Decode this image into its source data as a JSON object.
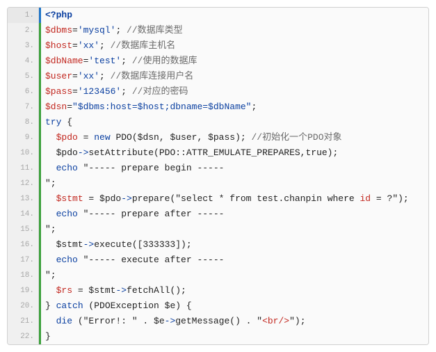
{
  "code": {
    "language": "php",
    "active_line": 1,
    "gutter_color": "#3ba03b",
    "active_gutter_color": "#1f74c7",
    "lines": [
      {
        "n": 1,
        "tokens": [
          {
            "t": "<?php",
            "c": "meta"
          }
        ]
      },
      {
        "n": 2,
        "tokens": [
          {
            "t": "$dbms",
            "c": "var"
          },
          {
            "t": "=",
            "c": "op"
          },
          {
            "t": "'mysql'",
            "c": "str"
          },
          {
            "t": "; ",
            "c": "op"
          },
          {
            "t": "//数据库类型",
            "c": "cmt"
          }
        ]
      },
      {
        "n": 3,
        "tokens": [
          {
            "t": "$host",
            "c": "var"
          },
          {
            "t": "=",
            "c": "op"
          },
          {
            "t": "'xx'",
            "c": "str"
          },
          {
            "t": "; ",
            "c": "op"
          },
          {
            "t": "//数据库主机名",
            "c": "cmt"
          }
        ]
      },
      {
        "n": 4,
        "tokens": [
          {
            "t": "$dbName",
            "c": "var"
          },
          {
            "t": "=",
            "c": "op"
          },
          {
            "t": "'test'",
            "c": "str"
          },
          {
            "t": "; ",
            "c": "op"
          },
          {
            "t": "//使用的数据库",
            "c": "cmt"
          }
        ]
      },
      {
        "n": 5,
        "tokens": [
          {
            "t": "$user",
            "c": "var"
          },
          {
            "t": "=",
            "c": "op"
          },
          {
            "t": "'xx'",
            "c": "str"
          },
          {
            "t": "; ",
            "c": "op"
          },
          {
            "t": "//数据库连接用户名",
            "c": "cmt"
          }
        ]
      },
      {
        "n": 6,
        "tokens": [
          {
            "t": "$pass",
            "c": "var"
          },
          {
            "t": "=",
            "c": "op"
          },
          {
            "t": "'123456'",
            "c": "str"
          },
          {
            "t": "; ",
            "c": "op"
          },
          {
            "t": "//对应的密码",
            "c": "cmt"
          }
        ]
      },
      {
        "n": 7,
        "tokens": [
          {
            "t": "$dsn",
            "c": "var"
          },
          {
            "t": "=",
            "c": "op"
          },
          {
            "t": "\"$dbms:host=$host;dbname=$dbName\"",
            "c": "str"
          },
          {
            "t": ";",
            "c": "op"
          }
        ]
      },
      {
        "n": 8,
        "tokens": [
          {
            "t": "try",
            "c": "kw"
          },
          {
            "t": " {",
            "c": "op"
          }
        ]
      },
      {
        "n": 9,
        "tokens": [
          {
            "t": "  ",
            "c": "plain"
          },
          {
            "t": "$pdo",
            "c": "var"
          },
          {
            "t": " = ",
            "c": "op"
          },
          {
            "t": "new",
            "c": "kw"
          },
          {
            "t": " PDO($dsn, $user, $pass); ",
            "c": "plain"
          },
          {
            "t": "//初始化一个PDO对象",
            "c": "cmt"
          }
        ]
      },
      {
        "n": 10,
        "tokens": [
          {
            "t": "  $pdo",
            "c": "plain"
          },
          {
            "t": "->",
            "c": "arrow"
          },
          {
            "t": "setAttribute(PDO::ATTR_EMULATE_PREPARES,true);",
            "c": "plain"
          }
        ]
      },
      {
        "n": 11,
        "tokens": [
          {
            "t": "  ",
            "c": "plain"
          },
          {
            "t": "echo",
            "c": "kw"
          },
          {
            "t": " \"----- prepare begin -----",
            "c": "plain"
          }
        ]
      },
      {
        "n": 12,
        "tokens": [
          {
            "t": "\";",
            "c": "plain"
          }
        ]
      },
      {
        "n": 13,
        "tokens": [
          {
            "t": "  ",
            "c": "plain"
          },
          {
            "t": "$stmt",
            "c": "var"
          },
          {
            "t": " = $pdo",
            "c": "plain"
          },
          {
            "t": "->",
            "c": "arrow"
          },
          {
            "t": "prepare(\"select * from test.chanpin where ",
            "c": "plain"
          },
          {
            "t": "id",
            "c": "id"
          },
          {
            "t": " = ?\");",
            "c": "plain"
          }
        ]
      },
      {
        "n": 14,
        "tokens": [
          {
            "t": "  ",
            "c": "plain"
          },
          {
            "t": "echo",
            "c": "kw"
          },
          {
            "t": " \"----- prepare after -----",
            "c": "plain"
          }
        ]
      },
      {
        "n": 15,
        "tokens": [
          {
            "t": "\";",
            "c": "plain"
          }
        ]
      },
      {
        "n": 16,
        "tokens": [
          {
            "t": "  $stmt",
            "c": "plain"
          },
          {
            "t": "->",
            "c": "arrow"
          },
          {
            "t": "execute([333333]);",
            "c": "plain"
          }
        ]
      },
      {
        "n": 17,
        "tokens": [
          {
            "t": "  ",
            "c": "plain"
          },
          {
            "t": "echo",
            "c": "kw"
          },
          {
            "t": " \"----- execute after -----",
            "c": "plain"
          }
        ]
      },
      {
        "n": 18,
        "tokens": [
          {
            "t": "\";",
            "c": "plain"
          }
        ]
      },
      {
        "n": 19,
        "tokens": [
          {
            "t": "  ",
            "c": "plain"
          },
          {
            "t": "$rs",
            "c": "var"
          },
          {
            "t": " = $stmt",
            "c": "plain"
          },
          {
            "t": "->",
            "c": "arrow"
          },
          {
            "t": "fetchAll();",
            "c": "plain"
          }
        ]
      },
      {
        "n": 20,
        "tokens": [
          {
            "t": "} ",
            "c": "op"
          },
          {
            "t": "catch",
            "c": "kw"
          },
          {
            "t": " (PDOException $e) {",
            "c": "plain"
          }
        ]
      },
      {
        "n": 21,
        "tokens": [
          {
            "t": "  ",
            "c": "plain"
          },
          {
            "t": "die",
            "c": "kw"
          },
          {
            "t": " (\"Error!: \" . $e",
            "c": "plain"
          },
          {
            "t": "->",
            "c": "arrow"
          },
          {
            "t": "getMessage() . \"",
            "c": "plain"
          },
          {
            "t": "<br/>",
            "c": "html"
          },
          {
            "t": "\");",
            "c": "plain"
          }
        ]
      },
      {
        "n": 22,
        "tokens": [
          {
            "t": "}",
            "c": "op"
          }
        ]
      }
    ]
  }
}
